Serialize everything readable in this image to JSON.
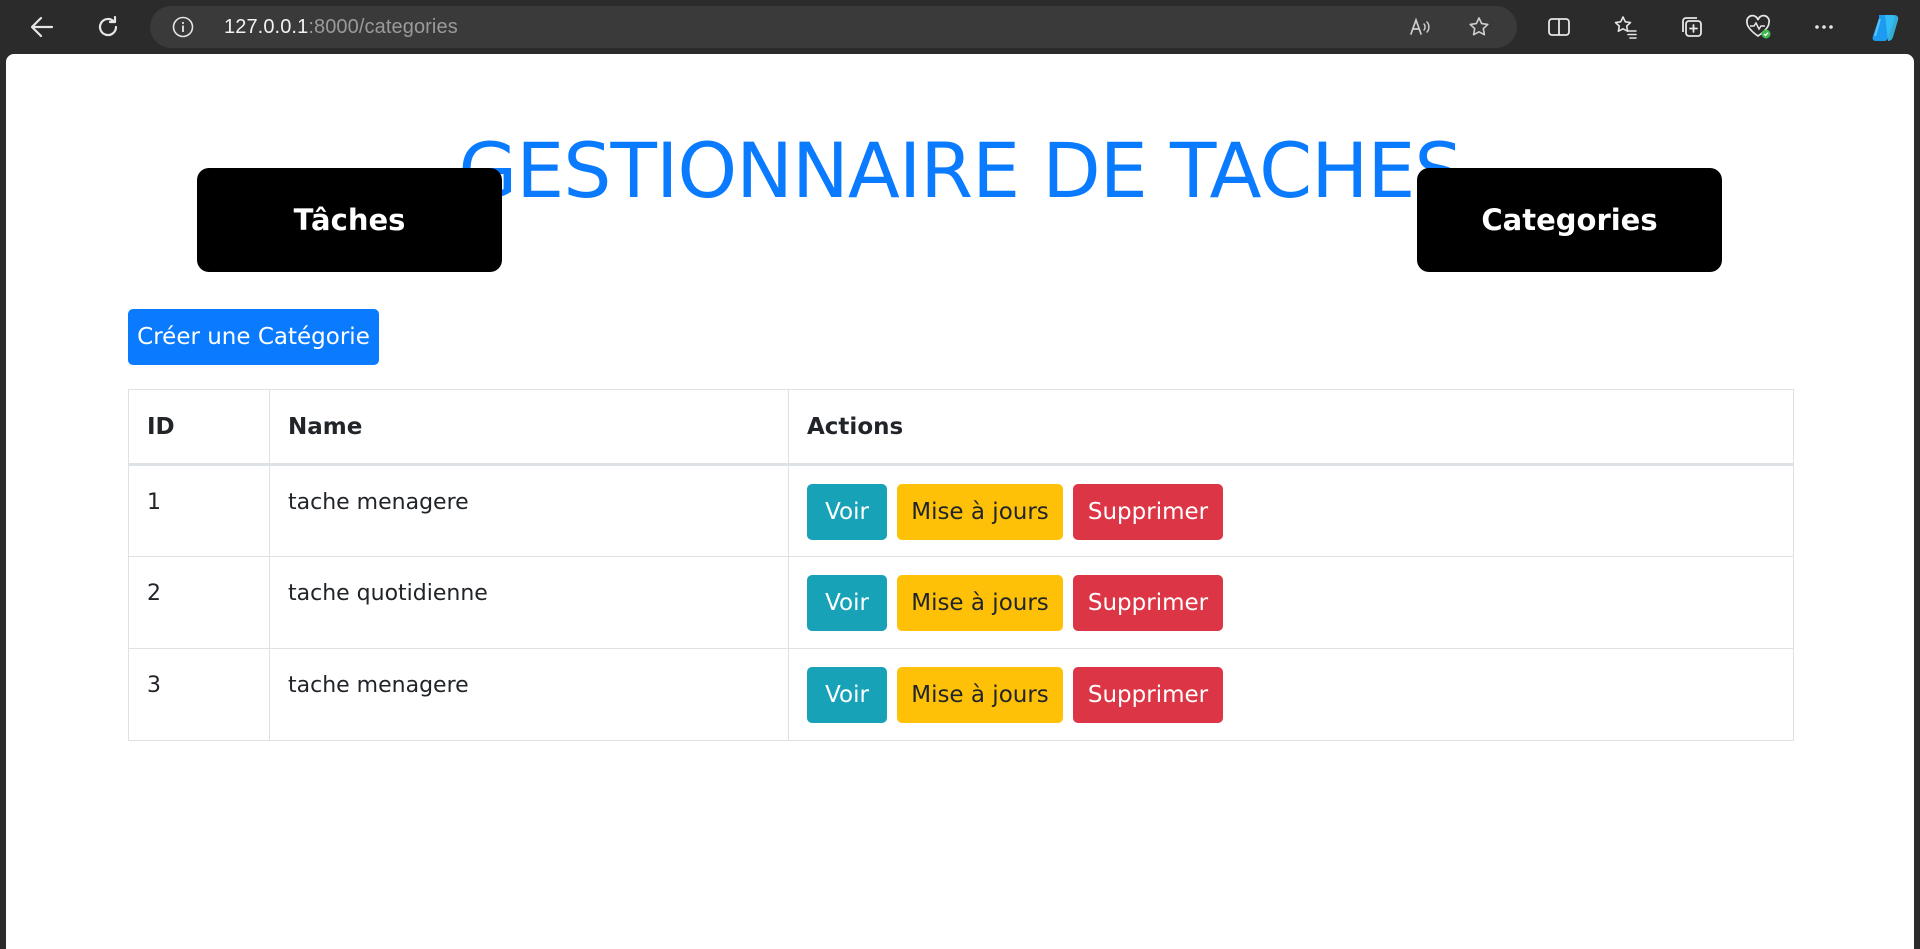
{
  "browser": {
    "url_host": "127.0.0.1",
    "url_rest": ":8000/categories",
    "icons": [
      "back-icon",
      "refresh-icon",
      "info-icon",
      "read-aloud-icon",
      "favorite-star-icon",
      "split-screen-icon",
      "favorites-icon",
      "collections-icon",
      "performance-icon",
      "more-icon",
      "copilot-icon"
    ]
  },
  "page": {
    "title": "GESTIONNAIRE DE TACHES",
    "nav": {
      "tasks": "Tâches",
      "categories": "Categories"
    },
    "create_button": "Créer une Catégorie",
    "table": {
      "headers": {
        "id": "ID",
        "name": "Name",
        "actions": "Actions"
      },
      "rows": [
        {
          "id": "1",
          "name": "tache menagere"
        },
        {
          "id": "2",
          "name": "tache quotidienne"
        },
        {
          "id": "3",
          "name": "tache menagere"
        }
      ],
      "action_labels": {
        "view": "Voir",
        "update": "Mise à jours",
        "delete": "Supprimer"
      }
    }
  },
  "colors": {
    "title": "#0a7bff",
    "primary": "#0a7bff",
    "info": "#17a2b8",
    "warning": "#ffc107",
    "danger": "#dc3545",
    "nav_bg": "#000000"
  }
}
